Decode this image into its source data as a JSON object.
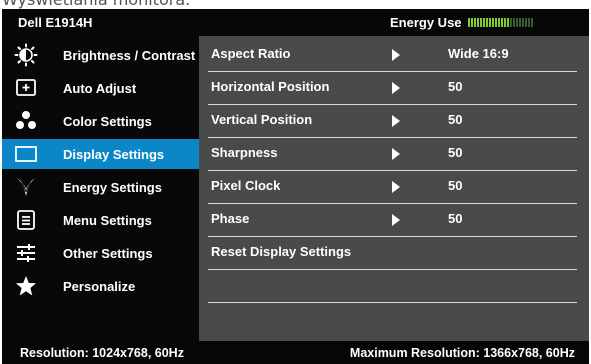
{
  "page_header_fragment": "Wyświetlania monitora.",
  "title_bar": {
    "model": "Dell E1914H",
    "energy_label": "Energy Use",
    "energy_level_fraction": 0.65,
    "colors": {
      "active": "#7ccf2f",
      "inactive": "#3c5a30"
    }
  },
  "sidebar": {
    "items": [
      {
        "label": "Brightness / Contrast",
        "icon": "brightness-icon"
      },
      {
        "label": "Auto Adjust",
        "icon": "auto-adjust-icon"
      },
      {
        "label": "Color Settings",
        "icon": "color-settings-icon"
      },
      {
        "label": "Display Settings",
        "icon": "display-settings-icon",
        "selected": true
      },
      {
        "label": "Energy Settings",
        "icon": "energy-leaf-icon"
      },
      {
        "label": "Menu Settings",
        "icon": "menu-settings-icon"
      },
      {
        "label": "Other Settings",
        "icon": "other-settings-icon"
      },
      {
        "label": "Personalize",
        "icon": "star-icon"
      }
    ],
    "selected_color": "#0b86c6"
  },
  "display_settings": {
    "rows": [
      {
        "label": "Aspect Ratio",
        "value": "Wide 16:9",
        "has_arrow": true
      },
      {
        "label": "Horizontal Position",
        "value": "50",
        "has_arrow": true
      },
      {
        "label": "Vertical Position",
        "value": "50",
        "has_arrow": true
      },
      {
        "label": "Sharpness",
        "value": "50",
        "has_arrow": true
      },
      {
        "label": "Pixel Clock",
        "value": "50",
        "has_arrow": true
      },
      {
        "label": "Phase",
        "value": "50",
        "has_arrow": true
      },
      {
        "label": "Reset Display Settings",
        "value": "",
        "has_arrow": false
      }
    ]
  },
  "footer": {
    "resolution": "Resolution: 1024x768, 60Hz",
    "max_resolution": "Maximum Resolution: 1366x768, 60Hz"
  }
}
